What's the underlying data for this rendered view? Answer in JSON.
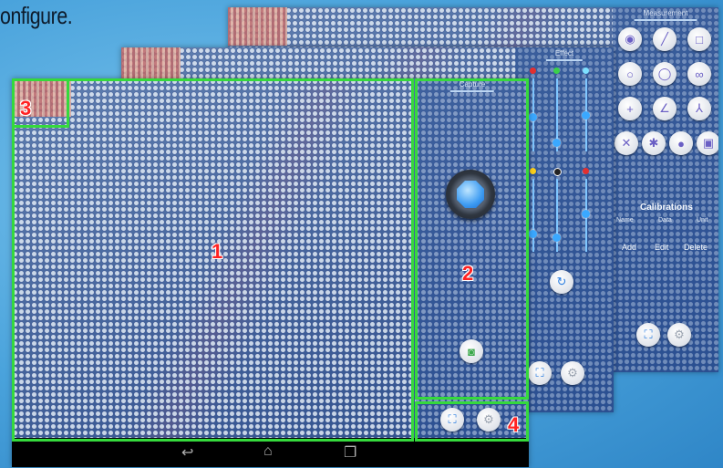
{
  "heading": "onfigure.",
  "screens": {
    "measurement": {
      "tab_label": "Measurement",
      "tool_icons": [
        "target-icon",
        "line-icon",
        "square-icon",
        "circle-icon",
        "ellipse-icon",
        "link-icon",
        "crosshair-icon",
        "angle-icon",
        "fork-icon",
        "x-cross-icon",
        "x-cross-alt-icon",
        "palette-icon",
        "save-icon"
      ],
      "calibrations_title": "Calibrations",
      "columns": [
        "Name",
        "Data",
        "Unit"
      ],
      "buttons": [
        "Add",
        "Edit",
        "Delete"
      ]
    },
    "effect": {
      "tab_label": "Effect"
    },
    "capture": {
      "tab_label": "Capture"
    }
  },
  "nav_icons": [
    "back-icon",
    "home-icon",
    "recents-icon"
  ],
  "callouts": [
    "1",
    "2",
    "3",
    "4"
  ],
  "colors": {
    "highlight": "#35d93c",
    "callout": "#ff2222"
  }
}
